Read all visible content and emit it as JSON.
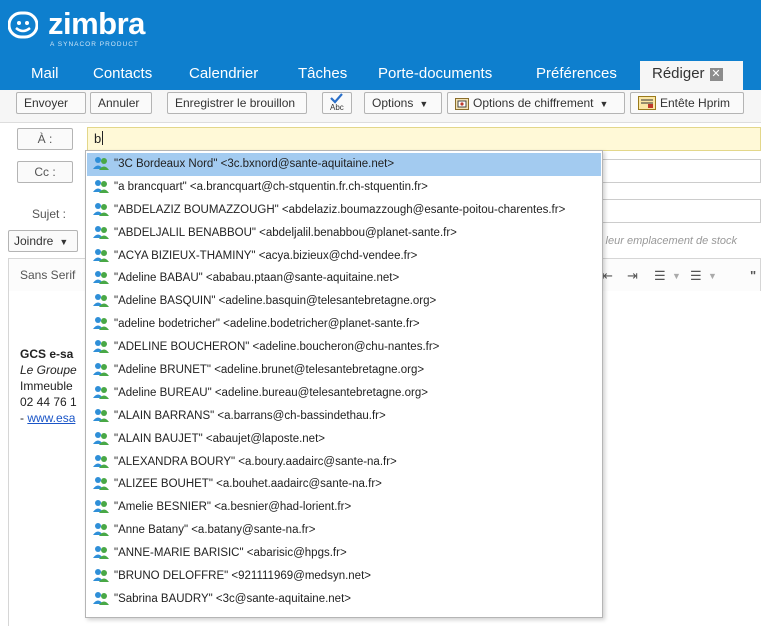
{
  "app": {
    "logo_text": "zimbra",
    "logo_sub": "A SYNACOR PRODUCT"
  },
  "nav": {
    "items": [
      "Mail",
      "Contacts",
      "Calendrier",
      "Tâches",
      "Porte-documents",
      "Préférences"
    ],
    "active_tab": "Rédiger",
    "close_glyph": "✕"
  },
  "toolbar": {
    "send": "Envoyer",
    "cancel": "Annuler",
    "save_draft": "Enregistrer le brouillon",
    "spell_check_icon": "spellcheck-icon",
    "spell_label": "Abc",
    "options": "Options",
    "encryption_options": "Options de chiffrement",
    "hprim_header": "Entête Hprim"
  },
  "compose": {
    "to_label": "À :",
    "to_value": "b",
    "cc_label": "Cc :",
    "subject_label": "Sujet :",
    "attach_label": "Joindre",
    "attach_hint": "s leur emplacement de stock"
  },
  "editor": {
    "font": "Sans Serif",
    "signature": {
      "org": "GCS e-sa",
      "tagline": "Le Groupe",
      "address": "Immeuble",
      "phone": "02 44 76 1",
      "link_prefix": "- ",
      "link": "www.esa"
    }
  },
  "autocomplete": {
    "selected_index": 0,
    "suggestions": [
      "\"3C Bordeaux Nord\" <3c.bxnord@sante-aquitaine.net>",
      "\"a brancquart\" <a.brancquart@ch-stquentin.fr.ch-stquentin.fr>",
      "\"ABDELAZIZ BOUMAZZOUGH\" <abdelaziz.boumazzough@esante-poitou-charentes.fr>",
      "\"ABDELJALIL BENABBOU\" <abdeljalil.benabbou@planet-sante.fr>",
      "\"ACYA BIZIEUX-THAMINY\" <acya.bizieux@chd-vendee.fr>",
      "\"Adeline BABAU\" <ababau.ptaan@sante-aquitaine.net>",
      "\"Adeline BASQUIN\" <adeline.basquin@telesantebretagne.org>",
      "\"adeline bodetricher\" <adeline.bodetricher@planet-sante.fr>",
      "\"ADELINE BOUCHERON\" <adeline.boucheron@chu-nantes.fr>",
      "\"Adeline BRUNET\" <adeline.brunet@telesantebretagne.org>",
      "\"Adeline BUREAU\" <adeline.bureau@telesantebretagne.org>",
      "\"ALAIN BARRANS\" <a.barrans@ch-bassindethau.fr>",
      "\"ALAIN BAUJET\" <abaujet@laposte.net>",
      "\"ALEXANDRA BOURY\" <a.boury.aadairc@sante-na.fr>",
      "\"ALIZEE BOUHET\" <a.bouhet.aadairc@sante-na.fr>",
      "\"Amelie BESNIER\" <a.besnier@had-lorient.fr>",
      "\"Anne Batany\" <a.batany@sante-na.fr>",
      "\"ANNE-MARIE BARISIC\" <abarisic@hpgs.fr>",
      "\"BRUNO DELOFFRE\" <921111969@medsyn.net>",
      "\"Sabrina BAUDRY\" <3c@sante-aquitaine.net>"
    ]
  },
  "colors": {
    "brand": "#0e7fce",
    "selected_row": "#a3cbf0",
    "to_field": "#fff9d7"
  }
}
